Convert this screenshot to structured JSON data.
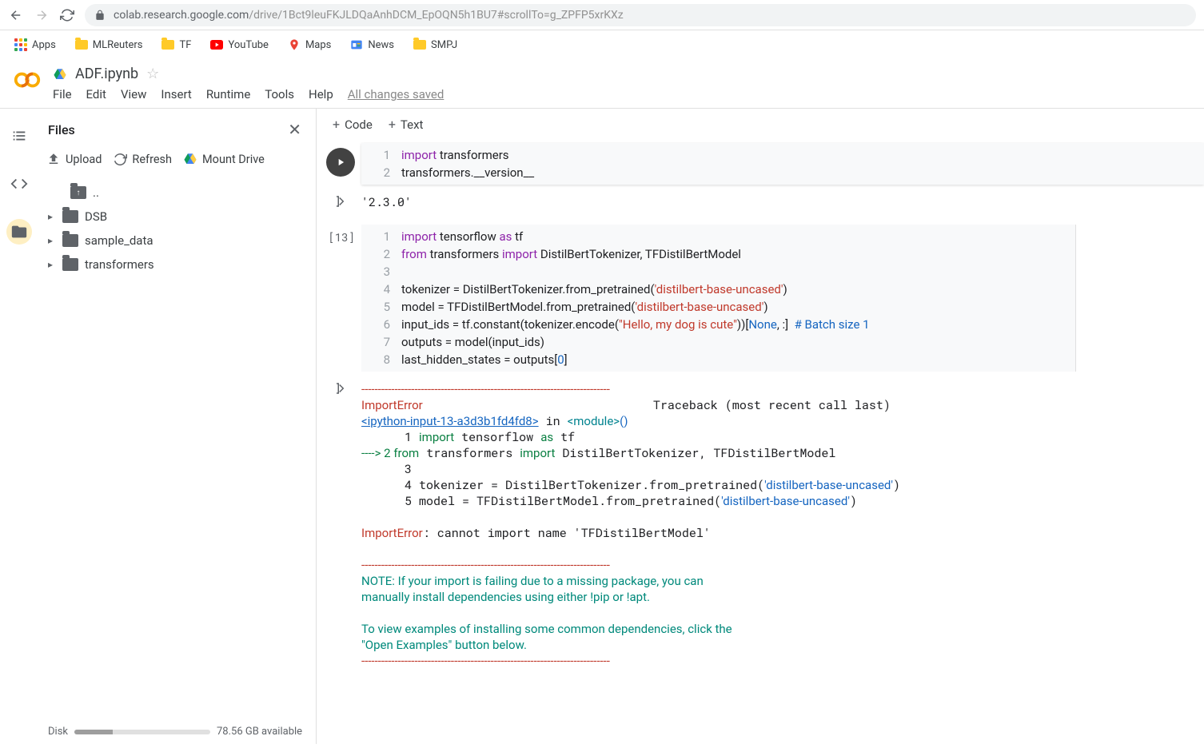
{
  "browser": {
    "url_host": "colab.research.google.com",
    "url_path": "/drive/1Bct9leuFKJLDQaAnhDCM_EpOQN5h1BU7#scrollTo=g_ZPFP5xrKXz"
  },
  "bookmarks": [
    {
      "icon": "apps",
      "label": "Apps"
    },
    {
      "icon": "folder",
      "label": "MLReuters"
    },
    {
      "icon": "folder",
      "label": "TF"
    },
    {
      "icon": "youtube",
      "label": "YouTube"
    },
    {
      "icon": "maps",
      "label": "Maps"
    },
    {
      "icon": "news",
      "label": "News"
    },
    {
      "icon": "folder",
      "label": "SMPJ"
    }
  ],
  "notebook": {
    "name": "ADF.ipynb",
    "menus": [
      "File",
      "Edit",
      "View",
      "Insert",
      "Runtime",
      "Tools",
      "Help"
    ],
    "saved_text": "All changes saved"
  },
  "files_panel": {
    "title": "Files",
    "actions": {
      "upload": "Upload",
      "refresh": "Refresh",
      "mount": "Mount Drive"
    },
    "tree": [
      {
        "name": "..",
        "up": true
      },
      {
        "name": "DSB"
      },
      {
        "name": "sample_data"
      },
      {
        "name": "transformers"
      }
    ],
    "disk_label": "Disk",
    "disk_avail": "78.56 GB available"
  },
  "toolbar": {
    "code": "Code",
    "text": "Text"
  },
  "cell1": {
    "lines": [
      {
        "n": "1",
        "html": "<span class='kw'>import</span> transformers"
      },
      {
        "n": "2",
        "html": "transformers.__version__"
      }
    ],
    "output": "'2.3.0'"
  },
  "cell2": {
    "prompt": "[13]",
    "lines": [
      {
        "n": "1",
        "html": "<span class='kw'>import</span> tensorflow <span class='kw'>as</span> tf"
      },
      {
        "n": "2",
        "html": "<span class='kw'>from</span> transformers <span class='kw'>import</span> DistilBertTokenizer, TFDistilBertModel"
      },
      {
        "n": "3",
        "html": ""
      },
      {
        "n": "4",
        "html": "tokenizer = DistilBertTokenizer.from_pretrained(<span class='str'>'distilbert-base-uncased'</span>)"
      },
      {
        "n": "5",
        "html": "model = TFDistilBertModel.from_pretrained(<span class='str'>'distilbert-base-uncased'</span>)"
      },
      {
        "n": "6",
        "html": "input_ids = tf.constant(tokenizer.encode(<span class='str'>\"Hello, my dog is cute\"</span>))[<span class='num'>None</span>, :]  <span class='cmt'># Batch size 1</span>"
      },
      {
        "n": "7",
        "html": "outputs = model(input_ids)"
      },
      {
        "n": "8",
        "html": "last_hidden_states = outputs[<span class='num'>0</span>]"
      }
    ]
  },
  "traceback": {
    "dash": "---------------------------------------------------------------------------",
    "err_name": "ImportError",
    "tb_label": "Traceback (most recent call last)",
    "frame": "<ipython-input-13-a3d3b1fd4fd8>",
    "in_text": " in ",
    "module": "<module>",
    "paren": "()",
    "lines": [
      {
        "pfx": "      1 ",
        "body": "import tensorflow as tf",
        "hl": false
      },
      {
        "pfx": "----> 2 ",
        "body": "from transformers import DistilBertTokenizer, TFDistilBertModel",
        "hl": true
      },
      {
        "pfx": "      3 ",
        "body": "",
        "hl": false
      },
      {
        "pfx": "      4 ",
        "body": "tokenizer = DistilBertTokenizer.from_pretrained('distilbert-base-uncased')",
        "hl": false
      },
      {
        "pfx": "      5 ",
        "body": "model = TFDistilBertModel.from_pretrained('distilbert-base-uncased')",
        "hl": false
      }
    ],
    "err_msg": "ImportError",
    "err_detail": ": cannot import name 'TFDistilBertModel'",
    "note1": "NOTE: If your import is failing due to a missing package, you can",
    "note2": "manually install dependencies using either !pip or !apt.",
    "note3": "To view examples of installing some common dependencies, click the",
    "note4": "\"Open Examples\" button below."
  }
}
